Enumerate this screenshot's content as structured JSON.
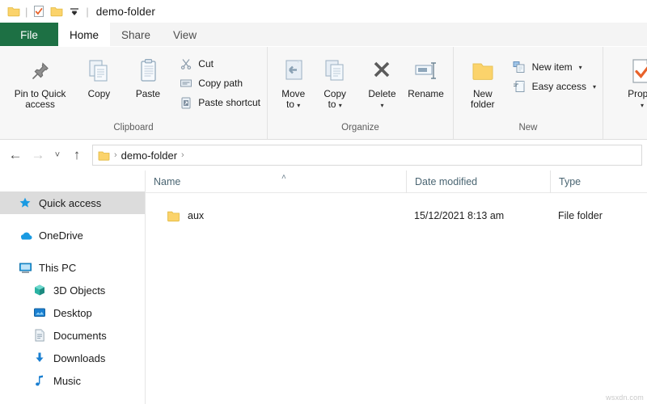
{
  "window": {
    "title": "demo-folder",
    "quick_access_icons": [
      "folder-icon",
      "properties-check-icon",
      "folder-icon",
      "customize-qat-icon"
    ]
  },
  "tabs": [
    {
      "label": "File",
      "state": "file",
      "accent": "#1d7044"
    },
    {
      "label": "Home",
      "state": "active"
    },
    {
      "label": "Share",
      "state": "inactive"
    },
    {
      "label": "View",
      "state": "inactive"
    }
  ],
  "ribbon": {
    "groups": [
      {
        "label": "Clipboard",
        "big_buttons": [
          {
            "label_line1": "Pin to Quick",
            "label_line2": "access",
            "icon": "pin-icon"
          },
          {
            "label_line1": "Copy",
            "label_line2": "",
            "icon": "copy-icon"
          },
          {
            "label_line1": "Paste",
            "label_line2": "",
            "icon": "paste-icon"
          }
        ],
        "small_buttons": [
          {
            "label": "Cut",
            "icon": "scissors-icon",
            "caret": false
          },
          {
            "label": "Copy path",
            "icon": "copy-path-icon",
            "caret": false
          },
          {
            "label": "Paste shortcut",
            "icon": "paste-shortcut-icon",
            "caret": false
          }
        ]
      },
      {
        "label": "Organize",
        "big_buttons": [
          {
            "label_line1": "Move",
            "label_line2": "to",
            "icon": "move-to-icon",
            "caret": true
          },
          {
            "label_line1": "Copy",
            "label_line2": "to",
            "icon": "copy-to-icon",
            "caret": true
          },
          {
            "label_line1": "Delete",
            "label_line2": "",
            "icon": "delete-x-icon",
            "caret_below": true
          },
          {
            "label_line1": "Rename",
            "label_line2": "",
            "icon": "rename-icon"
          }
        ],
        "small_buttons": []
      },
      {
        "label": "New",
        "big_buttons": [
          {
            "label_line1": "New",
            "label_line2": "folder",
            "icon": "new-folder-icon"
          }
        ],
        "small_buttons": [
          {
            "label": "New item",
            "icon": "new-item-icon",
            "caret": true
          },
          {
            "label": "Easy access",
            "icon": "easy-access-icon",
            "caret": true
          }
        ]
      },
      {
        "label": "",
        "big_buttons": [
          {
            "label_line1": "Proper",
            "label_line2": "",
            "icon": "properties-icon",
            "caret_below": true
          }
        ],
        "small_buttons": []
      }
    ]
  },
  "addressbar": {
    "back_icon": "arrow-left-icon",
    "forward_icon": "arrow-right-icon",
    "recent_icon": "chevron-down-icon",
    "up_icon": "arrow-up-icon",
    "breadcrumb_icon": "folder-icon",
    "crumbs": [
      "demo-folder"
    ],
    "separator": "›"
  },
  "navpane": {
    "items": [
      {
        "label": "Quick access",
        "icon": "star-icon",
        "selected": true,
        "indent": false
      },
      {
        "label": "OneDrive",
        "icon": "cloud-icon",
        "selected": false,
        "indent": false,
        "gap_before": true
      },
      {
        "label": "This PC",
        "icon": "monitor-icon",
        "selected": false,
        "indent": false,
        "gap_before": true
      },
      {
        "label": "3D Objects",
        "icon": "cube-icon",
        "selected": false,
        "indent": true
      },
      {
        "label": "Desktop",
        "icon": "desktop-icon",
        "selected": false,
        "indent": true
      },
      {
        "label": "Documents",
        "icon": "document-icon",
        "selected": false,
        "indent": true
      },
      {
        "label": "Downloads",
        "icon": "download-icon",
        "selected": false,
        "indent": true
      },
      {
        "label": "Music",
        "icon": "music-note-icon",
        "selected": false,
        "indent": true
      }
    ]
  },
  "filelist": {
    "columns": [
      {
        "label": "Name",
        "sorted": true,
        "sort_caret": "˄"
      },
      {
        "label": "Date modified",
        "sorted": false
      },
      {
        "label": "Type",
        "sorted": false
      }
    ],
    "rows": [
      {
        "name": "aux",
        "icon": "folder-icon",
        "date_modified": "15/12/2021 8:13 am",
        "type": "File folder"
      }
    ]
  },
  "watermark": {
    "text": "wsxdn.com"
  },
  "colors": {
    "file_tab_green": "#1d7044",
    "folder_yellow": "#fbd36b",
    "accent_blue": "#1a8cd8",
    "ribbon_bg": "#f7f7f7",
    "selection_gray": "#dcdcdc",
    "column_header_text": "#4a6572"
  }
}
